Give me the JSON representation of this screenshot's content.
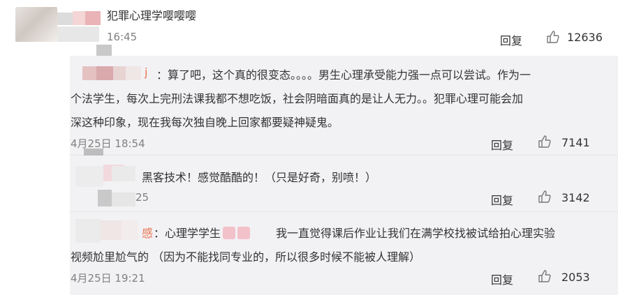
{
  "main_comment": {
    "username": "犯罪心理学嘤嘤嘤",
    "time": "16:45",
    "reply_label": "回复",
    "likes": "12636"
  },
  "replies": [
    {
      "username_partial": "j",
      "lines": [
        "：算了吧，这个真的很变态。。。。男生心理承受能力强一点可以尝试。作为一",
        "个法学生，每次上完刑法课我都不想吃饭，社会阴暗面真的是让人无力。。犯罪心理可能会加",
        "深这种印象，现在我每次独自晚上回家都要疑神疑鬼。"
      ],
      "time": "4月25日 18:54",
      "reply_label": "回复",
      "likes": "7141"
    },
    {
      "text": "黑客技术！感觉酷酷的！（只是好奇，别喷！）",
      "time_partial": "25",
      "reply_label": "回复",
      "likes": "3142"
    },
    {
      "username_partial": "感",
      "line1_main": "：心理学学生",
      "line1_rest": "我一直觉得课后作业让我们在满学校找被试给拍心理实验",
      "line2": "视频尬里尬气的 （因为不能找同专业的，所以很多时候不能被人理解）",
      "time": "4月25日 19:21",
      "reply_label": "回复",
      "likes": "2053"
    }
  ],
  "colors": {
    "reply_bg": "#f2f2f5",
    "meta_text": "#808080",
    "body_text": "#333333",
    "emoji_pink": "#f3c1c9",
    "username_orange": "#eb7350"
  },
  "icons": [
    "like-icon",
    "avatar",
    "emoji-icon"
  ]
}
